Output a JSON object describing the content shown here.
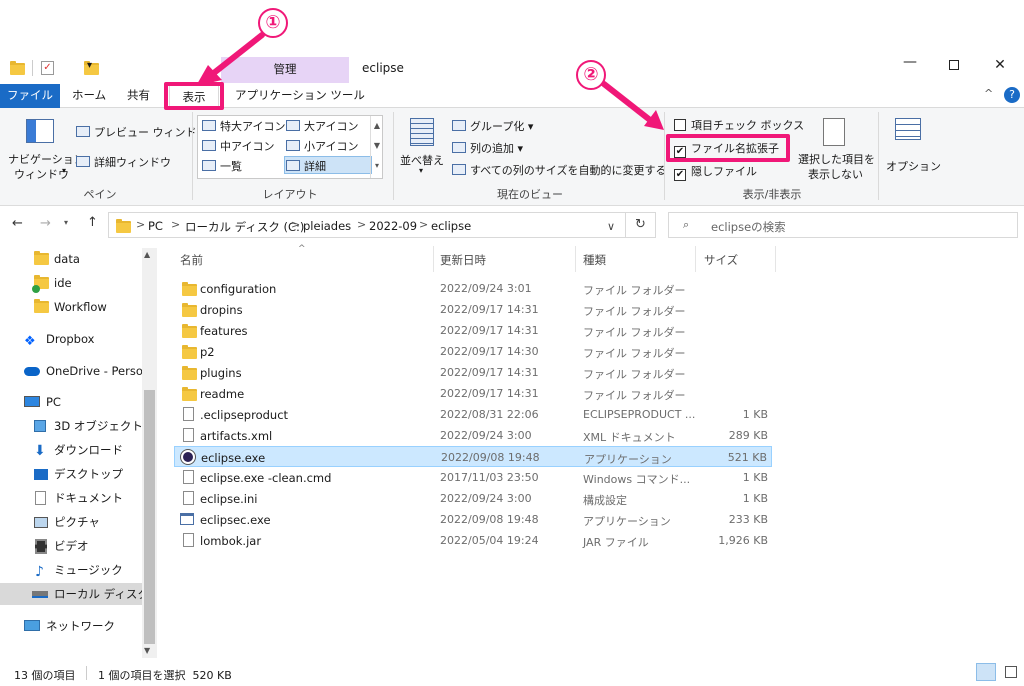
{
  "window": {
    "title": "eclipse",
    "context_tab": "管理"
  },
  "tabs": [
    "ファイル",
    "ホーム",
    "共有",
    "表示",
    "アプリケーション ツール"
  ],
  "ribbon": {
    "pane": {
      "nav_pane_l1": "ナビゲーション",
      "nav_pane_l2": "ウィンドウ",
      "preview": "プレビュー ウィンドウ",
      "details": "詳細ウィンドウ",
      "label": "ペイン"
    },
    "layout": {
      "xl_icons": "特大アイコン",
      "l_icons": "大アイコン",
      "m_icons": "中アイコン",
      "s_icons": "小アイコン",
      "list": "一覧",
      "details": "詳細",
      "label": "レイアウト"
    },
    "current_view": {
      "sort_l1": "並べ替え",
      "group": "グループ化",
      "add_column": "列の追加",
      "autosize": "すべての列のサイズを自動的に変更する",
      "label": "現在のビュー"
    },
    "show_hide": {
      "item_checkbox": "項目チェック ボックス",
      "file_ext": "ファイル名拡張子",
      "hidden": "隠しファイル",
      "hide_sel_l1": "選択した項目を",
      "hide_sel_l2": "表示しない",
      "label": "表示/非表示"
    },
    "options": "オプション"
  },
  "address": {
    "crumbs": [
      "PC",
      "ローカル ディスク (C:)",
      "pleiades",
      "2022-09",
      "eclipse"
    ],
    "search_placeholder": "eclipseの検索"
  },
  "nav": {
    "items": [
      "data",
      "ide",
      "Workflow",
      "Dropbox",
      "OneDrive - Persor",
      "PC",
      "3D オブジェクト",
      "ダウンロード",
      "デスクトップ",
      "ドキュメント",
      "ピクチャ",
      "ビデオ",
      "ミュージック",
      "ローカル ディスク (C",
      "ネットワーク"
    ]
  },
  "columns": {
    "name": "名前",
    "date": "更新日時",
    "type": "種類",
    "size": "サイズ"
  },
  "files": [
    {
      "name": "configuration",
      "date": "2022/09/24 3:01",
      "type": "ファイル フォルダー",
      "size": ""
    },
    {
      "name": "dropins",
      "date": "2022/09/17 14:31",
      "type": "ファイル フォルダー",
      "size": ""
    },
    {
      "name": "features",
      "date": "2022/09/17 14:31",
      "type": "ファイル フォルダー",
      "size": ""
    },
    {
      "name": "p2",
      "date": "2022/09/17 14:30",
      "type": "ファイル フォルダー",
      "size": ""
    },
    {
      "name": "plugins",
      "date": "2022/09/17 14:31",
      "type": "ファイル フォルダー",
      "size": ""
    },
    {
      "name": "readme",
      "date": "2022/09/17 14:31",
      "type": "ファイル フォルダー",
      "size": ""
    },
    {
      "name": ".eclipseproduct",
      "date": "2022/08/31 22:06",
      "type": "ECLIPSEPRODUCT ...",
      "size": "1 KB"
    },
    {
      "name": "artifacts.xml",
      "date": "2022/09/24 3:00",
      "type": "XML ドキュメント",
      "size": "289 KB"
    },
    {
      "name": "eclipse.exe",
      "date": "2022/09/08 19:48",
      "type": "アプリケーション",
      "size": "521 KB"
    },
    {
      "name": "eclipse.exe -clean.cmd",
      "date": "2017/11/03 23:50",
      "type": "Windows コマンド...",
      "size": "1 KB"
    },
    {
      "name": "eclipse.ini",
      "date": "2022/09/24 3:00",
      "type": "構成設定",
      "size": "1 KB"
    },
    {
      "name": "eclipsec.exe",
      "date": "2022/09/08 19:48",
      "type": "アプリケーション",
      "size": "233 KB"
    },
    {
      "name": "lombok.jar",
      "date": "2022/05/04 19:24",
      "type": "JAR ファイル",
      "size": "1,926 KB"
    }
  ],
  "status": {
    "count": "13 個の項目",
    "selected": "1 個の項目を選択  520 KB"
  },
  "annotations": {
    "one": "①",
    "two": "②",
    "color": "#f01878"
  },
  "accent": "#1a6bc6",
  "selection_color": "#cce8ff"
}
